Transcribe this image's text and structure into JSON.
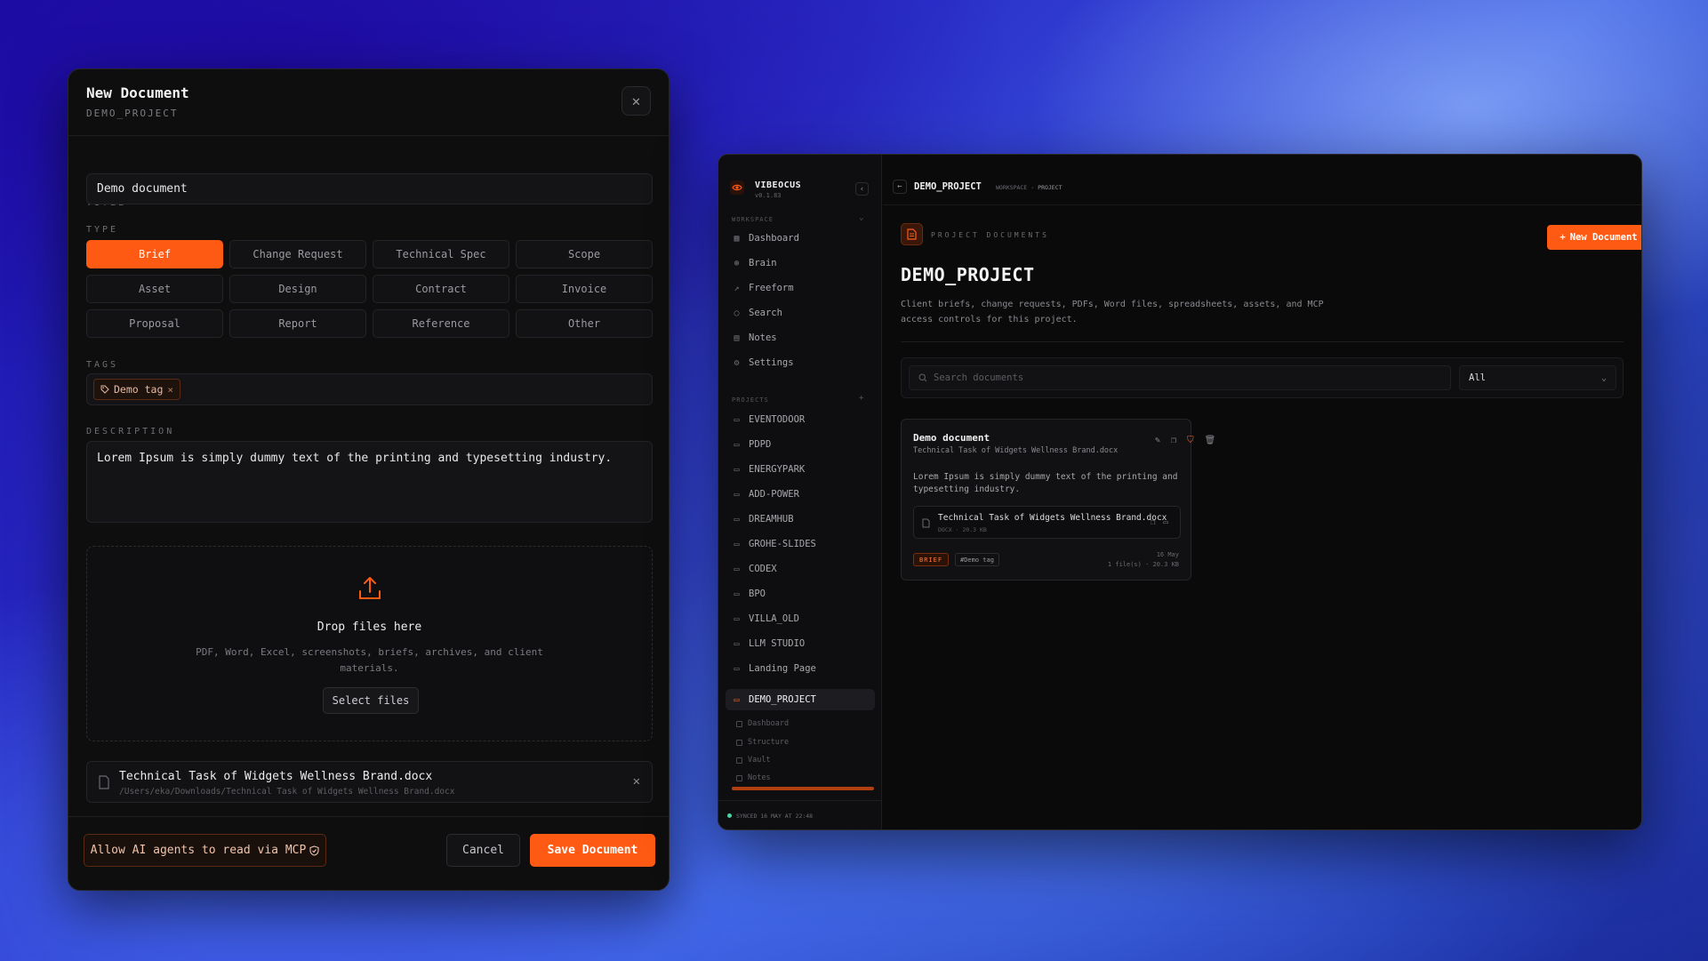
{
  "modal": {
    "title": "New Document",
    "project": "DEMO_PROJECT",
    "close_icon": "close-icon",
    "title_label": "TITLE",
    "title_value": "Demo document",
    "type_label": "TYPE",
    "types": [
      "Brief",
      "Change Request",
      "Technical Spec",
      "Scope",
      "Asset",
      "Design",
      "Contract",
      "Invoice",
      "Proposal",
      "Report",
      "Reference",
      "Other"
    ],
    "selected_type": "Brief",
    "tags_label": "TAGS",
    "tags": [
      "Demo tag"
    ],
    "description_label": "DESCRIPTION",
    "description_value": "Lorem Ipsum is simply dummy text of the printing and typesetting industry.",
    "drop_title": "Drop files here",
    "drop_description": "PDF, Word, Excel, screenshots, briefs, archives, and client materials.",
    "select_files_label": "Select files",
    "file": {
      "name": "Technical Task of Widgets Wellness Brand.docx",
      "path": "/Users/eka/Downloads/Technical Task of Widgets Wellness Brand.docx"
    },
    "mcp_label": "Allow AI agents to read via MCP",
    "cancel_label": "Cancel",
    "save_label": "Save Document"
  },
  "app": {
    "brand": "VIBEOCUS",
    "version": "v0.1.83",
    "workspace_label": "WORKSPACE",
    "workspace_items": [
      {
        "label": "Dashboard",
        "icon": "dashboard-icon"
      },
      {
        "label": "Brain",
        "icon": "brain-icon"
      },
      {
        "label": "Freeform",
        "icon": "freeform-icon"
      },
      {
        "label": "Search",
        "icon": "search-icon"
      },
      {
        "label": "Notes",
        "icon": "notes-icon"
      },
      {
        "label": "Settings",
        "icon": "settings-icon"
      }
    ],
    "projects_label": "PROJECTS",
    "projects": [
      "EVENTODOOR",
      "PDPD",
      "ENERGYPARK",
      "ADD-POWER",
      "DREAMHUB",
      "GROHE-SLIDES",
      "CODEX",
      "BPO",
      "VILLA_OLD",
      "LLM STUDIO",
      "Landing Page",
      "DEMO_PROJECT"
    ],
    "active_project": "DEMO_PROJECT",
    "project_subitems": [
      "Dashboard",
      "Structure",
      "Vault",
      "Notes"
    ],
    "sync_status": "SYNCED 16 MAY AT 22:48",
    "topbar": {
      "title": "DEMO_PROJECT",
      "breadcrumb": [
        "WORKSPACE",
        "PROJECT"
      ]
    },
    "main": {
      "kicker": "PROJECT DOCUMENTS",
      "new_document_label": "New Document",
      "title": "DEMO_PROJECT",
      "description": "Client briefs, change requests, PDFs, Word files, spreadsheets, assets, and MCP access controls for this project.",
      "search_placeholder": "Search documents",
      "filter_value": "All"
    },
    "card": {
      "title": "Demo document",
      "file": "Technical Task of Widgets Wellness Brand.docx",
      "description": "Lorem Ipsum is simply dummy text of the printing and typesetting industry.",
      "attachment_name": "Technical Task of Widgets Wellness Brand.docx",
      "attachment_meta": "DOCX · 20.3 KB",
      "type_badge": "BRIEF",
      "tag_badge": "#Demo tag",
      "date": "16 May",
      "stats": "1 file(s) · 20.3 KB"
    }
  },
  "colors": {
    "accent": "#ff5a14",
    "panel": "#0e0e0f",
    "sync_dot": "#4fd1a0"
  }
}
